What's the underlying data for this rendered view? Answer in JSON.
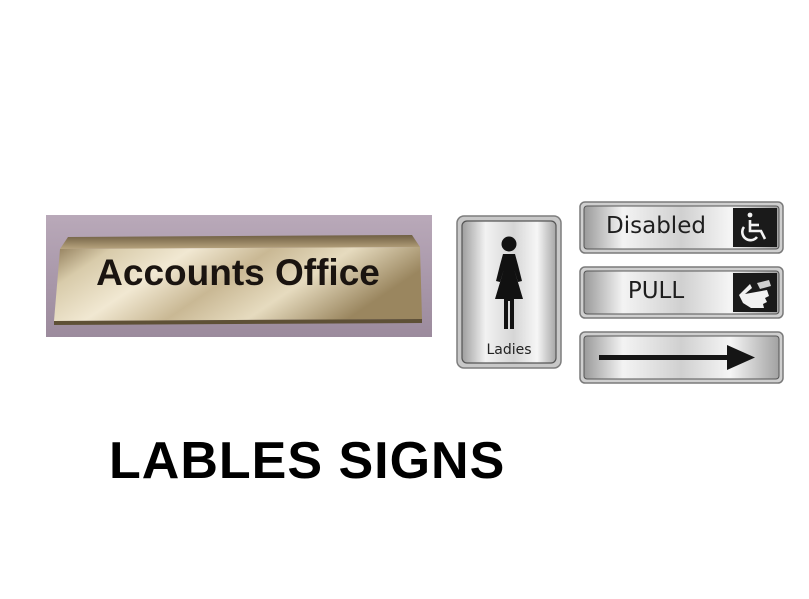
{
  "signs": {
    "accounts_office": "Accounts Office",
    "ladies": "Ladies",
    "disabled": "Disabled",
    "pull": "PULL"
  },
  "icons": {
    "ladies": "woman-figure-icon",
    "disabled": "wheelchair-icon",
    "pull": "pointing-hand-icon",
    "arrow": "arrow-right-icon"
  },
  "title": "LABLES SIGNS",
  "colors": {
    "brass_light": "#e8dcc0",
    "brass_dark": "#8a7650",
    "steel_light": "#f4f4f4",
    "steel_dark": "#a8a8a8",
    "ink": "#111111"
  }
}
